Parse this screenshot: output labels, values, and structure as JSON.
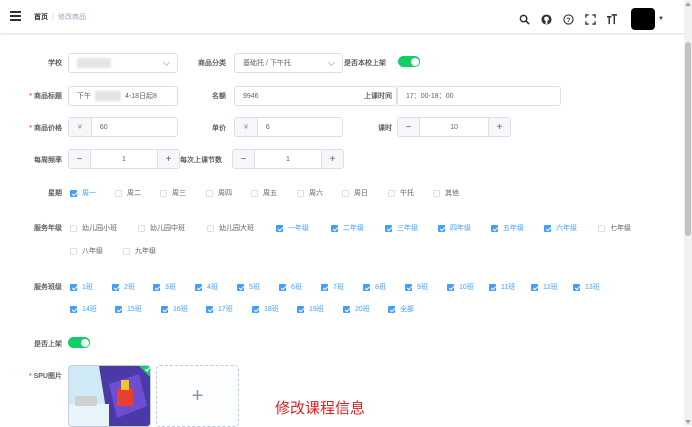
{
  "header": {
    "breadcrumb_home": "首页",
    "breadcrumb_sep": "/",
    "breadcrumb_current": "修改商品",
    "icons": [
      "search-icon",
      "github-icon",
      "help-icon",
      "fullscreen-icon",
      "font-size-icon"
    ],
    "icon_glyphs": {
      "search": "⚲",
      "github": "◉",
      "help": "?",
      "fullscreen": "⛶",
      "font": "T"
    }
  },
  "form": {
    "school_label": "学校",
    "category_label": "商品分类",
    "category_value": "基础托 / 下午托",
    "is_school_listed_label": "是否本校上架",
    "title_label": "商品标题",
    "title_value_prefix": "下午",
    "title_value_suffix": "4-18日起8",
    "quota_label": "名额",
    "quota_value": "9946",
    "class_time_label": "上课时间",
    "class_time_value": "17：00-18：00",
    "price_label": "商品价格",
    "price_prefix": "¥",
    "price_value": "60",
    "unit_price_label": "单价",
    "unit_price_prefix": "¥",
    "unit_price_value": "6",
    "lessons_label": "课时",
    "lessons_value": "10",
    "weekly_freq_label": "每周频率",
    "weekly_freq_value": "1",
    "lessons_per_time_label": "每次上课节数",
    "lessons_per_time_value": "1",
    "weekday_label": "星期",
    "weekdays": [
      {
        "label": "周一",
        "checked": true
      },
      {
        "label": "周二",
        "checked": false
      },
      {
        "label": "周三",
        "checked": false
      },
      {
        "label": "周四",
        "checked": false
      },
      {
        "label": "周五",
        "checked": false
      },
      {
        "label": "周六",
        "checked": false
      },
      {
        "label": "周日",
        "checked": false
      },
      {
        "label": "午托",
        "checked": false
      },
      {
        "label": "其他",
        "checked": false
      }
    ],
    "grade_label": "服务年级",
    "grades": [
      {
        "label": "幼儿园小班",
        "checked": false
      },
      {
        "label": "幼儿园中班",
        "checked": false
      },
      {
        "label": "幼儿园大班",
        "checked": false
      },
      {
        "label": "一年级",
        "checked": true
      },
      {
        "label": "二年级",
        "checked": true
      },
      {
        "label": "三年级",
        "checked": true
      },
      {
        "label": "四年级",
        "checked": true
      },
      {
        "label": "五年级",
        "checked": true
      },
      {
        "label": "六年级",
        "checked": true
      },
      {
        "label": "七年级",
        "checked": false
      },
      {
        "label": "八年级",
        "checked": false
      },
      {
        "label": "九年级",
        "checked": false
      }
    ],
    "class_label": "服务班级",
    "classes": [
      {
        "label": "1班",
        "checked": true
      },
      {
        "label": "2班",
        "checked": true
      },
      {
        "label": "3班",
        "checked": true
      },
      {
        "label": "4班",
        "checked": true
      },
      {
        "label": "5班",
        "checked": true
      },
      {
        "label": "6班",
        "checked": true
      },
      {
        "label": "7班",
        "checked": true
      },
      {
        "label": "8班",
        "checked": true
      },
      {
        "label": "9班",
        "checked": true
      },
      {
        "label": "10班",
        "checked": true
      },
      {
        "label": "11班",
        "checked": true
      },
      {
        "label": "12班",
        "checked": true
      },
      {
        "label": "13班",
        "checked": true
      },
      {
        "label": "14班",
        "checked": true
      },
      {
        "label": "15班",
        "checked": true
      },
      {
        "label": "16班",
        "checked": true
      },
      {
        "label": "17班",
        "checked": true
      },
      {
        "label": "18班",
        "checked": true
      },
      {
        "label": "19班",
        "checked": true
      },
      {
        "label": "20班",
        "checked": true
      },
      {
        "label": "全部",
        "checked": true
      }
    ],
    "listed_label": "是否上架",
    "spu_label": "SPU图片",
    "upload_plus": "+"
  },
  "annotation": "修改课程信息",
  "colors": {
    "primary": "#409eff",
    "switch_on": "#13ce66",
    "required": "#f56c6c",
    "annotation": "#e02020"
  }
}
